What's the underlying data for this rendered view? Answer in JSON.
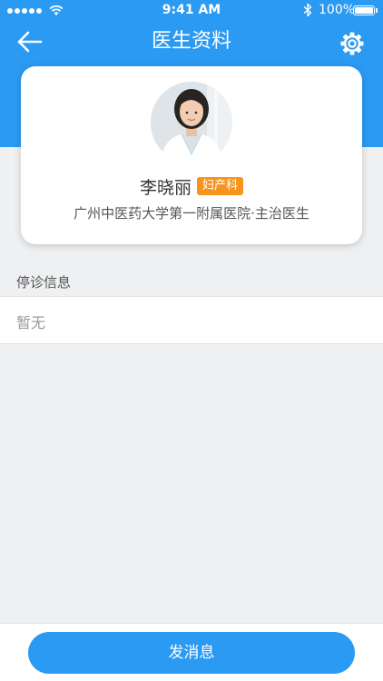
{
  "status_bar": {
    "time": "9:41 AM",
    "battery_percent": "100%",
    "signal_bars": 5
  },
  "nav": {
    "title": "医生资料",
    "back_icon": "arrow-left-icon",
    "settings_icon": "gear-icon"
  },
  "doctor": {
    "name": "李晓丽",
    "department": "妇产科",
    "hospital_title": "广州中医药大学第一附属医院·主治医生"
  },
  "suspension": {
    "label": "停诊信息",
    "value": "暂无"
  },
  "actions": {
    "send_message": "发消息"
  },
  "colors": {
    "primary": "#2b9af3",
    "badge": "#f7941d",
    "background": "#eef0f2"
  }
}
